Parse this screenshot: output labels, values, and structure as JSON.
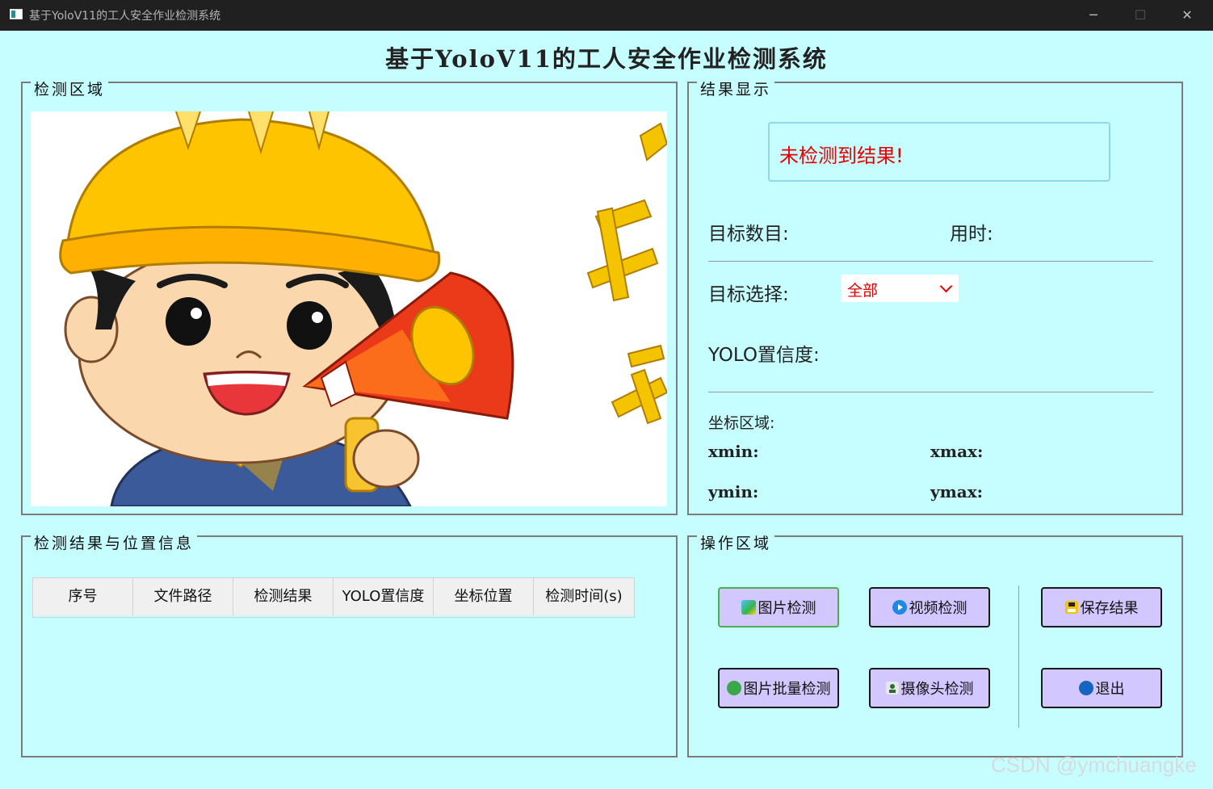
{
  "window": {
    "title": "基于YoloV11的工人安全作业检测系统",
    "controls": {
      "minimize": "─",
      "maximize": "☐",
      "close": "✕"
    }
  },
  "app": {
    "title": "基于YoloV11的工人安全作业检测系统"
  },
  "detection_area": {
    "title": "检测区域",
    "image": "cartoon-worker-with-megaphone"
  },
  "results": {
    "title": "结果显示",
    "status": "未检测到结果!",
    "target_count_label": "目标数目:",
    "time_label": "用时:",
    "target_select_label": "目标选择:",
    "target_select_value": "全部",
    "confidence_label": "YOLO置信度:",
    "coords_label": "坐标区域:",
    "xmin": "xmin:",
    "xmax": "xmax:",
    "ymin": "ymin:",
    "ymax": "ymax:"
  },
  "table": {
    "title": "检测结果与位置信息",
    "columns": [
      "序号",
      "文件路径",
      "检测结果",
      "YOLO置信度",
      "坐标位置",
      "检测时间(s)"
    ]
  },
  "operations": {
    "title": "操作区域",
    "buttons": {
      "image_detect": "图片检测",
      "video_detect": "视频检测",
      "save_result": "保存结果",
      "batch_detect": "图片批量检测",
      "camera_detect": "摄像头检测",
      "exit": "退出"
    }
  },
  "colors": {
    "background": "#c6fdff",
    "button": "#d3c7ff",
    "status_text": "#e60000"
  },
  "watermark": "CSDN @ymchuangke"
}
